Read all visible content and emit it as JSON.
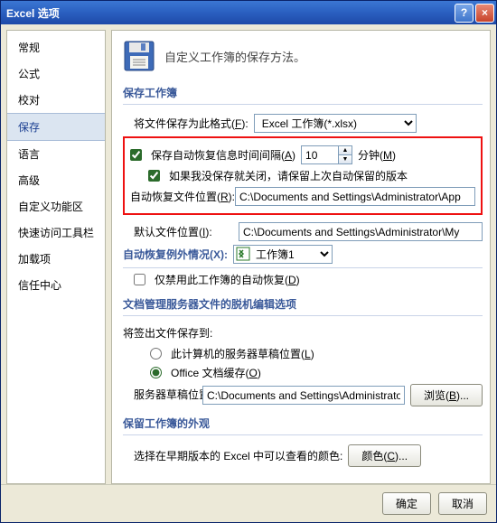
{
  "title": "Excel 选项",
  "titlebar_buttons": {
    "help": "?",
    "close": "×"
  },
  "sidebar": {
    "items": [
      {
        "label": "常规"
      },
      {
        "label": "公式"
      },
      {
        "label": "校对"
      },
      {
        "label": "保存",
        "selected": true
      },
      {
        "label": "语言"
      },
      {
        "label": "高级"
      },
      {
        "label": "自定义功能区"
      },
      {
        "label": "快速访问工具栏"
      },
      {
        "label": "加载项"
      },
      {
        "label": "信任中心"
      }
    ]
  },
  "heading": "自定义工作簿的保存方法。",
  "sections": {
    "save_workbook": "保存工作簿",
    "autorecover_except": "自动恢复例外情况(X):",
    "offline": "文档管理服务器文件的脱机编辑选项",
    "appearance": "保留工作簿的外观"
  },
  "fields": {
    "save_format_label_pre": "将文件保存为此格式(",
    "save_format_key": "F",
    "save_format_label_post": "):",
    "save_format_value": "Excel 工作簿(*.xlsx)",
    "autosave_label_pre": "保存自动恢复信息时间间隔(",
    "autosave_key": "A",
    "autosave_label_post": ")",
    "autosave_value": "10",
    "minutes_pre": "分钟(",
    "minutes_key": "M",
    "minutes_post": ")",
    "keep_last_label": "如果我没保存就关闭，请保留上次自动保留的版本",
    "autorecover_loc_label_pre": "自动恢复文件位置(",
    "autorecover_loc_key": "R",
    "autorecover_loc_label_post": "):",
    "autorecover_loc_value": "C:\\Documents and Settings\\Administrator\\App",
    "default_loc_label_pre": "默认文件位置(",
    "default_loc_key": "I",
    "default_loc_label_post": "):",
    "default_loc_value": "C:\\Documents and Settings\\Administrator\\My",
    "workbook_value": "工作簿1",
    "disable_autorecover_pre": "仅禁用此工作簿的自动恢复(",
    "disable_autorecover_key": "D",
    "disable_autorecover_post": ")",
    "checkout_label": "将签出文件保存到:",
    "radio_server_pre": "此计算机的服务器草稿位置(",
    "radio_server_key": "L",
    "radio_server_post": ")",
    "radio_office_pre": "Office 文档缓存(",
    "radio_office_key": "O",
    "radio_office_post": ")",
    "server_draft_label_pre": "服务器草稿位置(",
    "server_draft_key": "V",
    "server_draft_label_post": "):",
    "server_draft_value": "C:\\Documents and Settings\\Administrator",
    "browse_pre": "浏览(",
    "browse_key": "B",
    "browse_post": "...",
    "appearance_label": "选择在早期版本的 Excel 中可以查看的颜色:",
    "colors_pre": "颜色(",
    "colors_key": "C",
    "colors_post": "..."
  },
  "footer": {
    "ok": "确定",
    "cancel": "取消"
  }
}
